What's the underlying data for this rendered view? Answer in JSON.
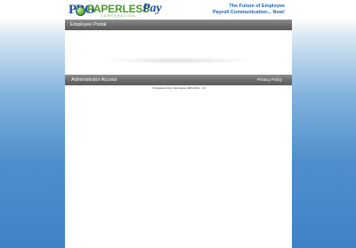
{
  "logo": {
    "pro": "PRO",
    "word": "PAPERLESS",
    "pay": "Pay",
    "corporation": "CORPORATION"
  },
  "tagline": {
    "line1": "The Future of Employee",
    "line2": "Payroll Communication... Now!"
  },
  "portal": {
    "title": "Employee Portal"
  },
  "admin": {
    "title": "Administrator Access",
    "privacy_link": "Privacy Policy"
  },
  "footer": {
    "copyright": "© Paperless Pay Corporation 2009-2021 - 10"
  },
  "colors": {
    "brand_blue": "#1d4f91",
    "brand_green": "#4c9b2f",
    "bar_gray": "#6b6b6b",
    "background_blue": "#3f82c6"
  }
}
